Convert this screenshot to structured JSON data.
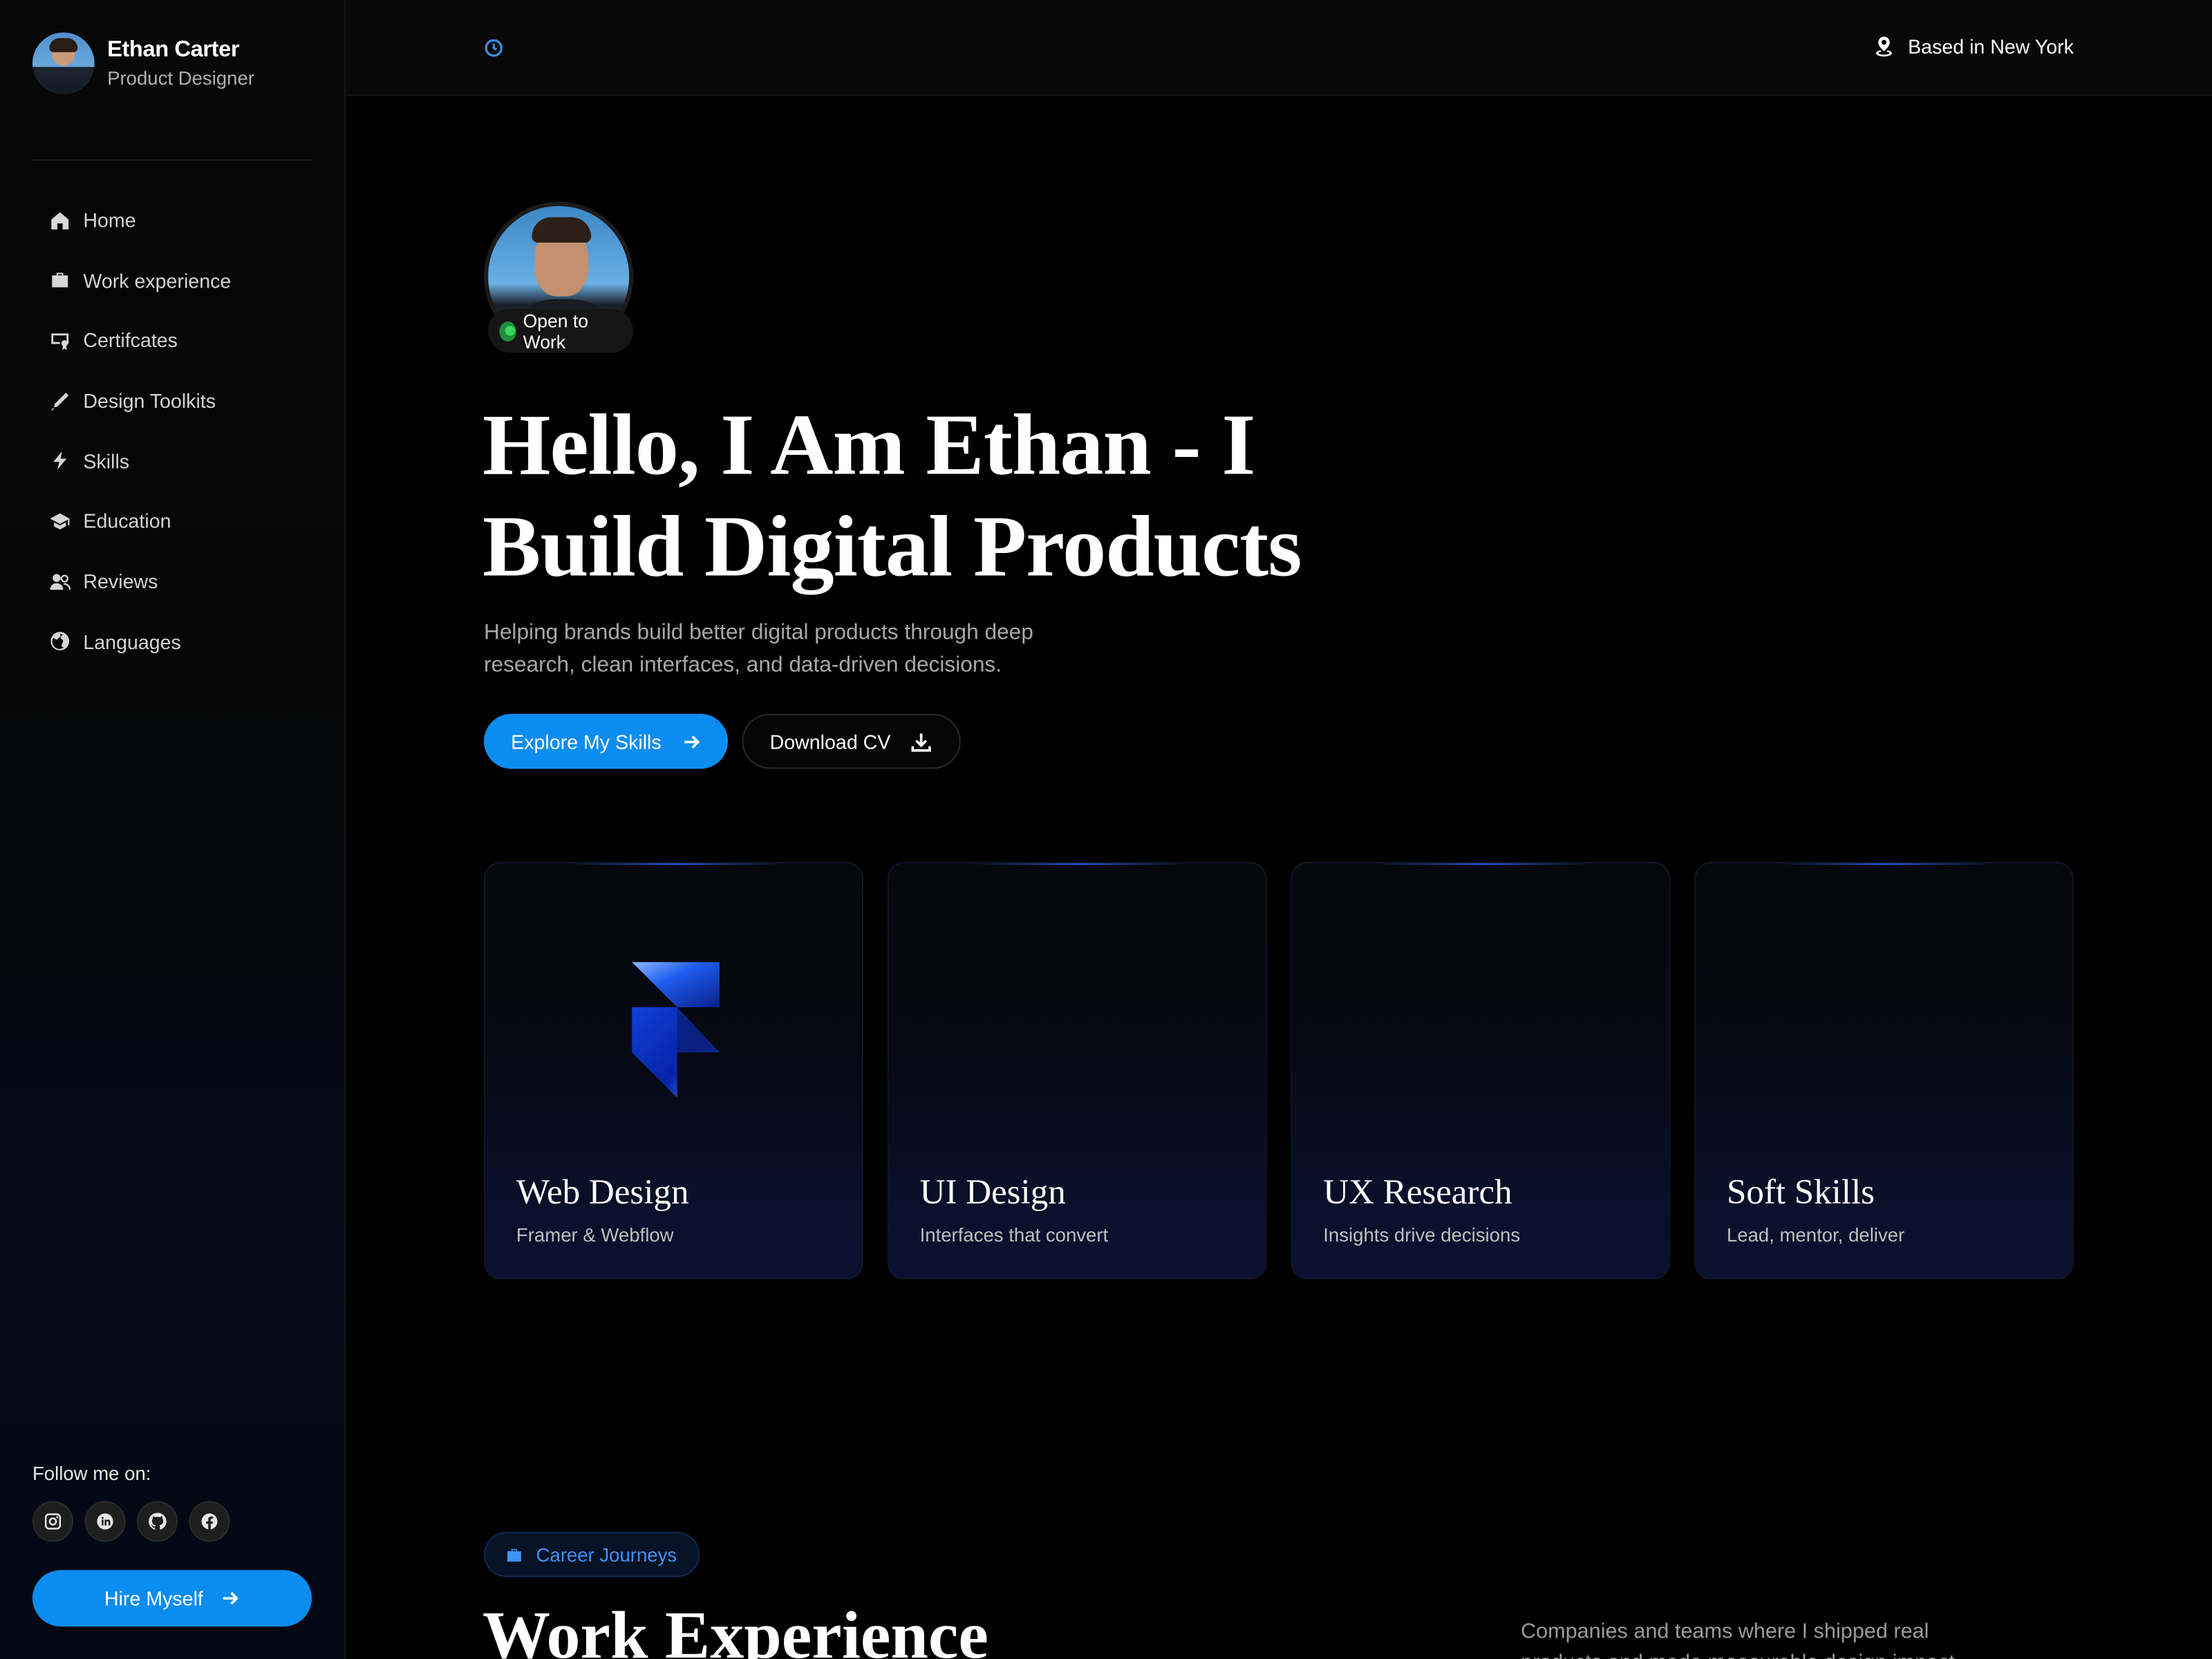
{
  "profile": {
    "name": "Ethan Carter",
    "role": "Product Designer"
  },
  "nav": [
    {
      "label": "Home",
      "icon": "home-icon"
    },
    {
      "label": "Work experience",
      "icon": "briefcase-icon"
    },
    {
      "label": "Certifcates",
      "icon": "certificate-icon"
    },
    {
      "label": "Design Toolkits",
      "icon": "pen-icon"
    },
    {
      "label": "Skills",
      "icon": "bolt-icon"
    },
    {
      "label": "Education",
      "icon": "graduation-cap-icon"
    },
    {
      "label": "Reviews",
      "icon": "users-icon"
    },
    {
      "label": "Languages",
      "icon": "globe-icon"
    }
  ],
  "social": {
    "label": "Follow me on:",
    "items": [
      "instagram-icon",
      "linkedin-icon",
      "github-icon",
      "facebook-icon"
    ]
  },
  "hire_button": "Hire Myself",
  "topbar": {
    "location": "Based in New York"
  },
  "hero": {
    "status": "Open to Work",
    "title": "Hello, I Am Ethan - I Build Digital Products",
    "subtitle": "Helping brands build better digital products through deep research, clean interfaces, and data-driven decisions.",
    "primary_button": "Explore My Skills",
    "secondary_button": "Download CV"
  },
  "cards": [
    {
      "title": "Web Design",
      "desc": "Framer & Webflow"
    },
    {
      "title": "UI Design",
      "desc": "Interfaces that convert"
    },
    {
      "title": "UX Research",
      "desc": "Insights drive decisions"
    },
    {
      "title": "Soft Skills",
      "desc": "Lead, mentor, deliver"
    }
  ],
  "career": {
    "badge": "Career Journeys",
    "title": "Work Experience",
    "subtitle": "Companies and teams where I shipped real products and made measurable design impact"
  },
  "colors": {
    "accent": "#0a8cf0",
    "status_green": "#3ad45f",
    "background": "#000000"
  }
}
